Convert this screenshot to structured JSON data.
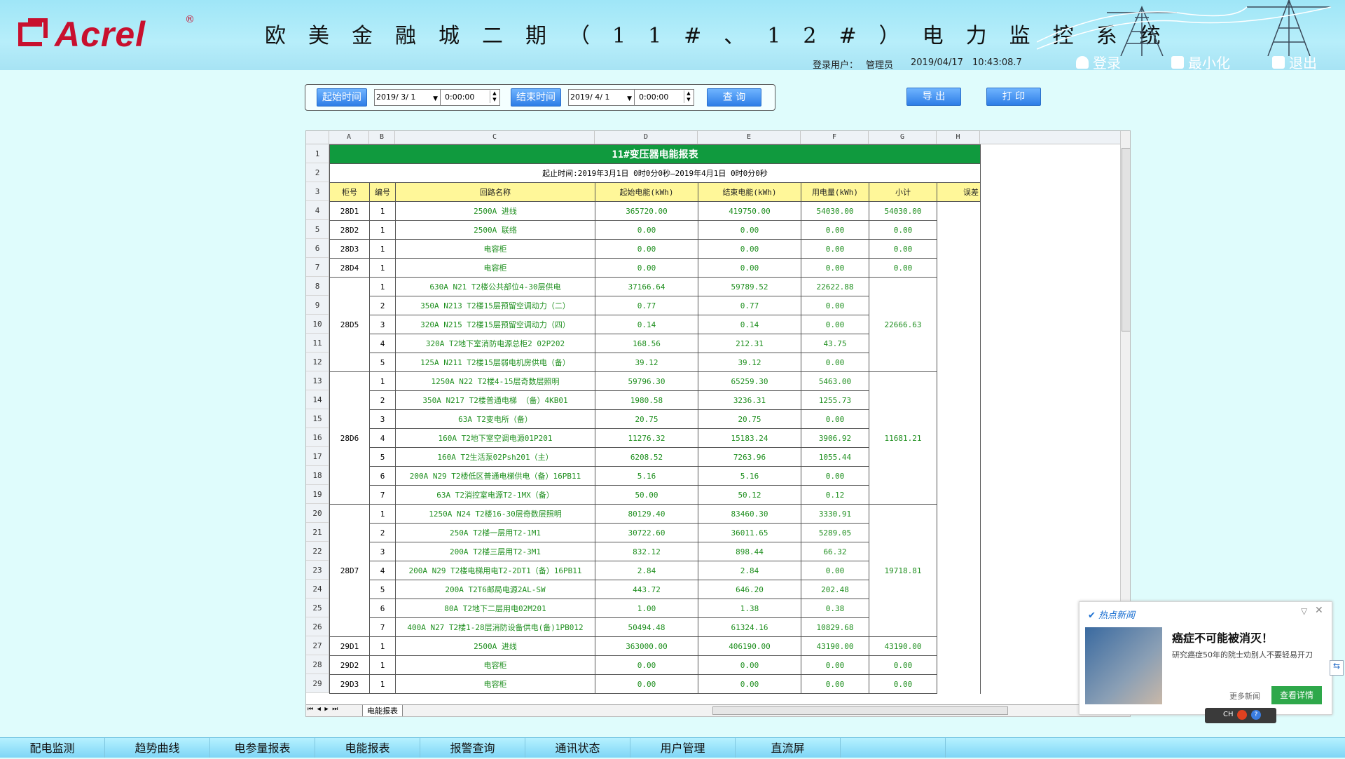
{
  "header": {
    "logo_text": "Acrel",
    "system_title": "欧美金融城二期（11#、12#）电力监控系统",
    "user_label": "登录用户：",
    "user_name": "管理员",
    "date": "2019/04/17",
    "time": "10:43:08.7",
    "login_label": "登录",
    "minimize_label": "最小化",
    "exit_label": "退出"
  },
  "toolbar": {
    "start_label": "起始时间",
    "start_date": "2019/ 3/ 1",
    "start_time": "0:00:00",
    "end_label": "结束时间",
    "end_date": "2019/ 4/ 1",
    "end_time": "0:00:00",
    "query_label": "查 询",
    "export_label": "导 出",
    "print_label": "打 印"
  },
  "sheet": {
    "column_letters": [
      "A",
      "B",
      "C",
      "D",
      "E",
      "F",
      "G",
      "H"
    ],
    "title": "11#变压器电能报表",
    "period": "起止时间:2019年3月1日 0时0分0秒—2019年4月1日 0时0分0秒",
    "headers": [
      "柜号",
      "编号",
      "回路名称",
      "起始电能(kWh)",
      "结束电能(kWh)",
      "用电量(kWh)",
      "小计",
      "误差"
    ],
    "groups": [
      {
        "cabinet": "28D1",
        "subtotal": "54030.00",
        "rows": [
          [
            "1",
            "2500A 进线",
            "365720.00",
            "419750.00",
            "54030.00"
          ]
        ]
      },
      {
        "cabinet": "28D2",
        "subtotal": "0.00",
        "rows": [
          [
            "1",
            "2500A 联络",
            "0.00",
            "0.00",
            "0.00"
          ]
        ]
      },
      {
        "cabinet": "28D3",
        "subtotal": "0.00",
        "rows": [
          [
            "1",
            "电容柜",
            "0.00",
            "0.00",
            "0.00"
          ]
        ]
      },
      {
        "cabinet": "28D4",
        "subtotal": "0.00",
        "rows": [
          [
            "1",
            "电容柜",
            "0.00",
            "0.00",
            "0.00"
          ]
        ]
      },
      {
        "cabinet": "28D5",
        "subtotal": "22666.63",
        "rows": [
          [
            "1",
            "630A N21 T2楼公共部位4-30层供电",
            "37166.64",
            "59789.52",
            "22622.88"
          ],
          [
            "2",
            "350A N213 T2楼15层预留空调动力（二）",
            "0.77",
            "0.77",
            "0.00"
          ],
          [
            "3",
            "320A N215 T2楼15层预留空调动力（四）",
            "0.14",
            "0.14",
            "0.00"
          ],
          [
            "4",
            "320A T2地下室消防电源总柜2 02P202",
            "168.56",
            "212.31",
            "43.75"
          ],
          [
            "5",
            "125A N211 T2楼15层弱电机房供电（备）",
            "39.12",
            "39.12",
            "0.00"
          ]
        ]
      },
      {
        "cabinet": "28D6",
        "subtotal": "11681.21",
        "rows": [
          [
            "1",
            "1250A N22 T2楼4-15层奇数层照明",
            "59796.30",
            "65259.30",
            "5463.00"
          ],
          [
            "2",
            "350A N217 T2楼普通电梯 （备）4KB01",
            "1980.58",
            "3236.31",
            "1255.73"
          ],
          [
            "3",
            "63A T2变电所（备）",
            "20.75",
            "20.75",
            "0.00"
          ],
          [
            "4",
            "160A T2地下室空调电源01P201",
            "11276.32",
            "15183.24",
            "3906.92"
          ],
          [
            "5",
            "160A T2生活泵02Psh201（主）",
            "6208.52",
            "7263.96",
            "1055.44"
          ],
          [
            "6",
            "200A N29 T2楼低区普通电梯供电（备）16PB11",
            "5.16",
            "5.16",
            "0.00"
          ],
          [
            "7",
            "63A T2消控室电源T2-1MX（备）",
            "50.00",
            "50.12",
            "0.12"
          ]
        ]
      },
      {
        "cabinet": "28D7",
        "subtotal": "19718.81",
        "rows": [
          [
            "1",
            "1250A N24 T2楼16-30层奇数层照明",
            "80129.40",
            "83460.30",
            "3330.91"
          ],
          [
            "2",
            "250A T2楼一层用T2-1M1",
            "30722.60",
            "36011.65",
            "5289.05"
          ],
          [
            "3",
            "200A T2楼三层用T2-3M1",
            "832.12",
            "898.44",
            "66.32"
          ],
          [
            "4",
            "200A N29 T2楼电梯用电T2-2DT1（备）16PB11",
            "2.84",
            "2.84",
            "0.00"
          ],
          [
            "5",
            "200A T2T6邮局电源2AL-SW",
            "443.72",
            "646.20",
            "202.48"
          ],
          [
            "6",
            "80A T2地下二层用电02M201",
            "1.00",
            "1.38",
            "0.38"
          ],
          [
            "7",
            "400A N27 T2楼1-28层消防设备供电(备)1PB012",
            "50494.48",
            "61324.16",
            "10829.68"
          ]
        ]
      },
      {
        "cabinet": "29D1",
        "subtotal": "43190.00",
        "rows": [
          [
            "1",
            "2500A 进线",
            "363000.00",
            "406190.00",
            "43190.00"
          ]
        ]
      },
      {
        "cabinet": "29D2",
        "subtotal": "0.00",
        "rows": [
          [
            "1",
            "电容柜",
            "0.00",
            "0.00",
            "0.00"
          ]
        ]
      },
      {
        "cabinet": "29D3",
        "subtotal": "0.00",
        "rows": [
          [
            "1",
            "电容柜",
            "0.00",
            "0.00",
            "0.00"
          ]
        ]
      }
    ],
    "sheet_tab": "电能报表"
  },
  "news": {
    "brand": "热点新闻",
    "headline": "癌症不可能被消灭！",
    "summary": "研究癌症50年的院士劝别人不要轻易开刀",
    "more": "更多新闻",
    "cta": "查看详情"
  },
  "ime": {
    "label": "CH"
  },
  "nav": [
    "配电监测",
    "趋势曲线",
    "电参量报表",
    "电能报表",
    "报警查询",
    "通讯状态",
    "用户管理",
    "直流屏"
  ],
  "colors": {
    "header_bg": "#a7e3f4",
    "page_bg": "#dffcfc",
    "title_green": "#109a3e",
    "header_yellow": "#fff799",
    "value_green": "#1f8f1f",
    "button_blue": "#2d7de6",
    "accent_red": "#c8102e"
  }
}
